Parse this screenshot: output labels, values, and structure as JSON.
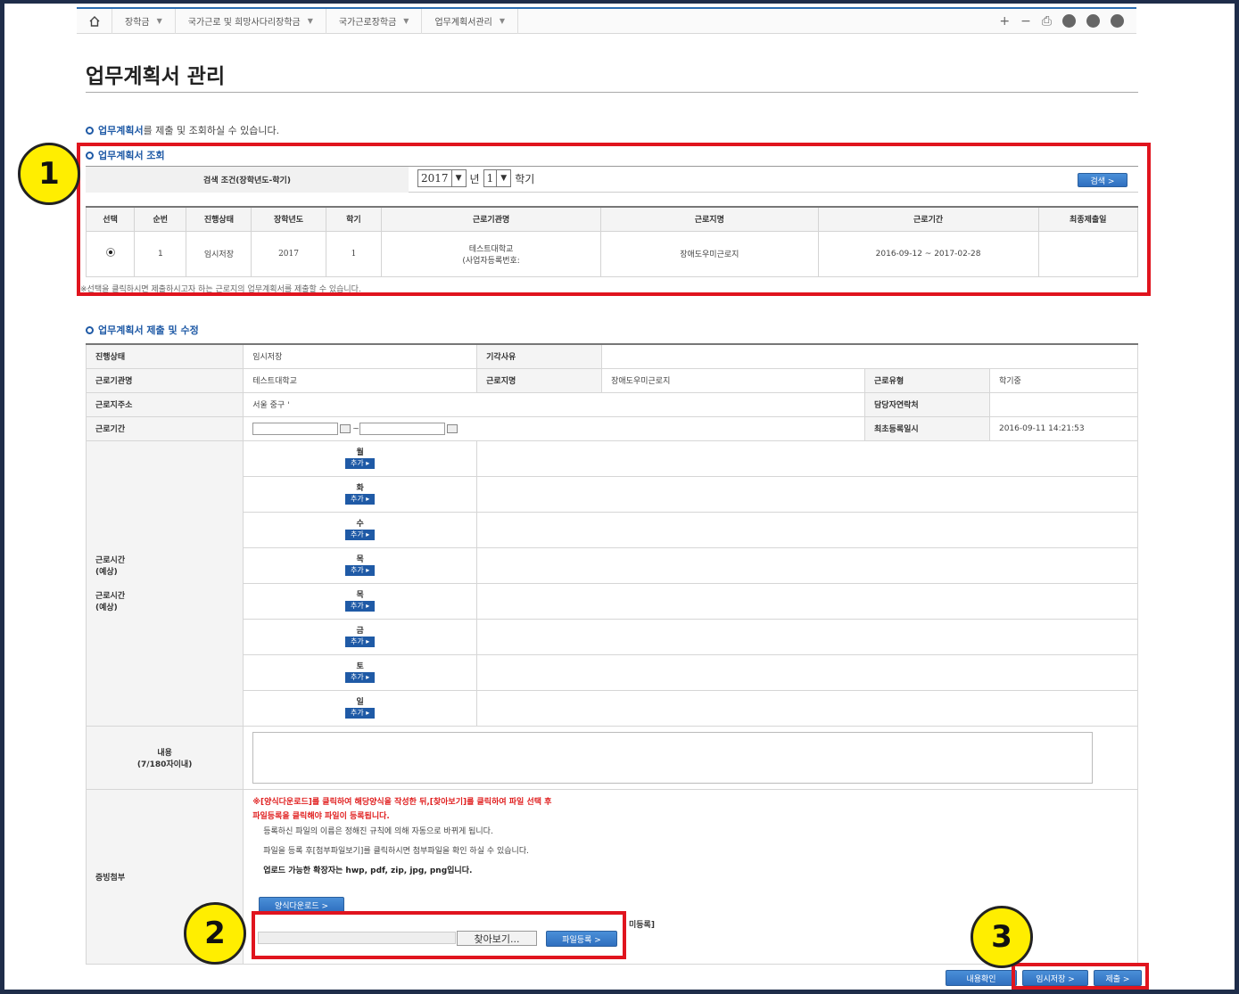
{
  "nav": {
    "items": [
      {
        "label": "장학금"
      },
      {
        "label": "국가근로 및 희망사다리장학금"
      },
      {
        "label": "국가근로장학금"
      },
      {
        "label": "업무계획서관리"
      }
    ],
    "right_tools": [
      "+",
      "−",
      "⎙"
    ]
  },
  "page": {
    "title": "업무계획서 관리",
    "intro_highlight": "업무계획서",
    "intro_rest": "를 제출 및 조회하실 수 있습니다."
  },
  "search": {
    "section_title": "업무계획서 조회",
    "label": "검색 조건(장학년도-학기)",
    "year": "2017",
    "year_unit": "년",
    "term": "1",
    "term_unit": "학기",
    "button": "검색 >"
  },
  "list": {
    "headers": [
      "선택",
      "순번",
      "진행상태",
      "장학년도",
      "학기",
      "근로기관명",
      "근로지명",
      "근로기간",
      "최종제출일"
    ],
    "row": {
      "seq": "1",
      "status": "임시저장",
      "year": "2017",
      "term": "1",
      "org_line1": "테스트대학교",
      "org_line2": "(사업자등록번호:",
      "site": "장애도우미근로지",
      "period": "2016-09-12 ~ 2017-02-28",
      "final_date": ""
    },
    "note": "※선택을 클릭하시면 제출하시고자 하는 근로지의 업무계획서를 제출할 수 있습니다."
  },
  "detail": {
    "section_title": "업무계획서 제출 및 수정",
    "status_label": "진행상태",
    "status_value": "임시저장",
    "reject_label": "기각사유",
    "org_label": "근로기관명",
    "org_value": "테스트대학교",
    "site_label": "근로지명",
    "site_value": "장애도우미근로지",
    "type_label": "근로유형",
    "type_value": "학기중",
    "address_label": "근로지주소",
    "address_value": "서울 중구 '",
    "contact_label": "담당자연락처",
    "period_label": "근로기간",
    "period_sep": "~",
    "first_reg_label": "최초등록일시",
    "first_reg_value": "2016-09-11 14:21:53",
    "hours_label_1": "근로시간",
    "hours_label_1b": "(예상)",
    "hours_label_2": "근로시간",
    "hours_label_2b": "(예상)",
    "days": [
      "월",
      "화",
      "수",
      "목",
      "목",
      "금",
      "토",
      "일"
    ],
    "add_label": "추가 ▸",
    "content_label": "내용",
    "content_sub": "(7/180자이내)",
    "attach_label": "증빙첨부",
    "attach_red_1": "※[양식다운로드]를 클릭하여 해당양식을 작성한 뒤,[찾아보기]를 클릭하여 파일 선택 후",
    "attach_red_2": "파일등록을 클릭해야 파일이 등록됩니다.",
    "attach_info_1": "등록하신 파일의 이름은 정해진 규칙에 의해 자동으로 바뀌게 됩니다.",
    "attach_info_2": "파일을 등록 후[첨부파일보기]를 클릭하시면 첨부파일을 확인 하실 수 있습니다.",
    "attach_info_3": "업로드 가능한 확장자는 hwp, pdf, zip, jpg, png입니다.",
    "form_download": "양식다운로드 >",
    "find_button": "찾아보기...",
    "file_register": "파일등록 >",
    "unregistered": "미등록]"
  },
  "actions": {
    "content_check": "내용확인",
    "temp_save": "임시저장 >",
    "submit": "제출 >"
  },
  "annotations": {
    "badge1": "1",
    "badge2": "2",
    "badge3": "3",
    "box_color": "#e0141e",
    "badge_color": "#ffee00"
  }
}
